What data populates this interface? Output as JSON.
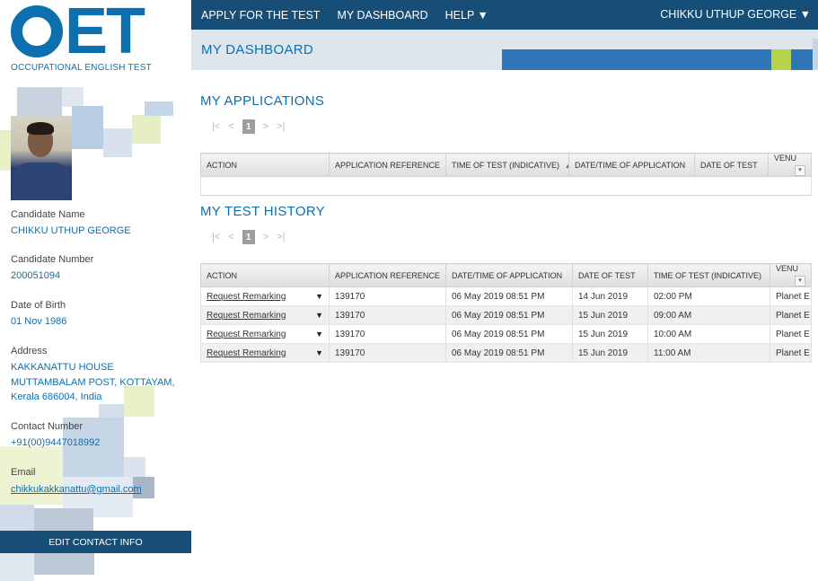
{
  "logo": {
    "letters": [
      "O",
      "E",
      "T"
    ],
    "tagline": "OCCUPATIONAL ENGLISH TEST"
  },
  "nav": {
    "items": [
      "APPLY FOR THE TEST",
      "MY DASHBOARD",
      "HELP ▼"
    ],
    "user": "CHIKKU UTHUP GEORGE ▼"
  },
  "page": {
    "title": "MY DASHBOARD"
  },
  "candidate": {
    "name_label": "Candidate Name",
    "name": "CHIKKU UTHUP GEORGE",
    "number_label": "Candidate Number",
    "number": "200051094",
    "dob_label": "Date of Birth",
    "dob": "01 Nov 1986",
    "address_label": "Address",
    "address_line1": "KAKKANATTU HOUSE",
    "address_line2": "MUTTAMBALAM POST, KOTTAYAM,",
    "address_line3": "Kerala 686004, India",
    "contact_label": "Contact Number",
    "contact": "+91(00)9447018992",
    "email_label": "Email",
    "email": "chikkukakkanattu@gmail.com",
    "edit_button": "EDIT CONTACT INFO"
  },
  "pager": {
    "first": "|<",
    "prev": "<",
    "page": "1",
    "next": ">",
    "last": ">|"
  },
  "applications": {
    "title": "MY APPLICATIONS",
    "columns": [
      "ACTION",
      "APPLICATION REFERENCE",
      "TIME OF TEST (INDICATIVE)",
      "DATE/TIME OF APPLICATION",
      "DATE OF TEST",
      "VENU"
    ],
    "sort_indicator": "▲"
  },
  "history": {
    "title": "MY TEST HISTORY",
    "columns": [
      "ACTION",
      "APPLICATION REFERENCE",
      "DATE/TIME OF APPLICATION",
      "DATE OF TEST",
      "TIME OF TEST (INDICATIVE)",
      "VENU"
    ],
    "rows": [
      {
        "action": "Request Remarking",
        "ref": "139170",
        "applied": "06 May 2019 08:51 PM",
        "date": "14 Jun 2019",
        "time": "02:00 PM",
        "venue": "Planet E"
      },
      {
        "action": "Request Remarking",
        "ref": "139170",
        "applied": "06 May 2019 08:51 PM",
        "date": "15 Jun 2019",
        "time": "09:00 AM",
        "venue": "Planet E"
      },
      {
        "action": "Request Remarking",
        "ref": "139170",
        "applied": "06 May 2019 08:51 PM",
        "date": "15 Jun 2019",
        "time": "10:00 AM",
        "venue": "Planet E"
      },
      {
        "action": "Request Remarking",
        "ref": "139170",
        "applied": "06 May 2019 08:51 PM",
        "date": "15 Jun 2019",
        "time": "11:00 AM",
        "venue": "Planet E"
      }
    ]
  },
  "icons": {
    "row_caret": "▼",
    "column_menu": "▾"
  },
  "colors": {
    "brand": "#0d6fae",
    "navy": "#164e78",
    "header_bg": "#dde6ec",
    "accent_green": "#b7d34a"
  }
}
